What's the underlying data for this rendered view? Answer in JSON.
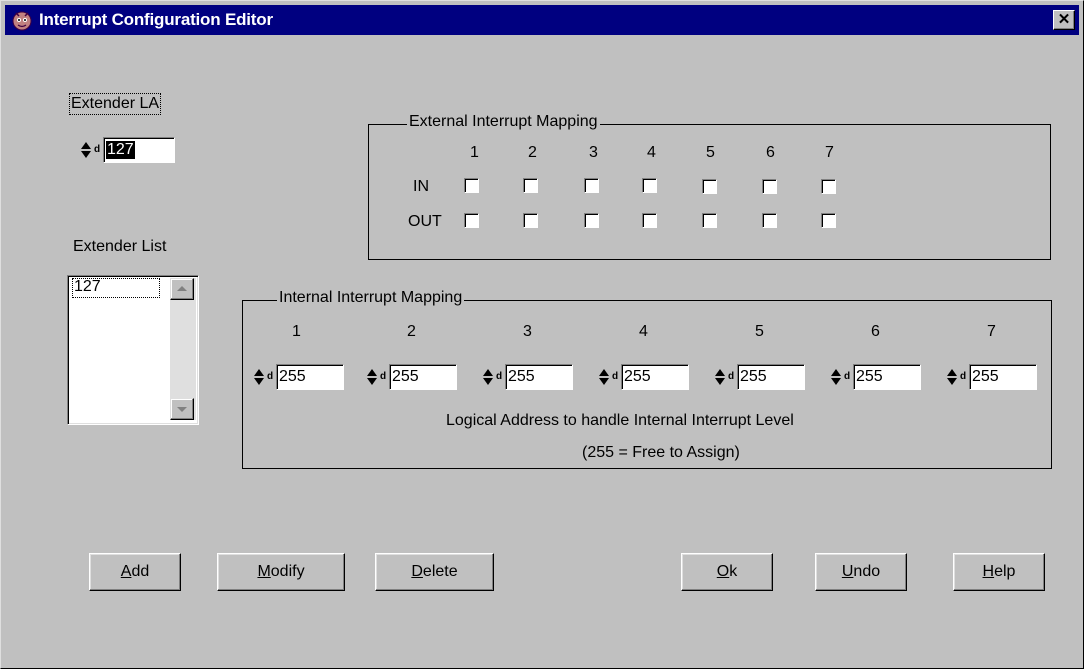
{
  "window": {
    "title": "Interrupt Configuration Editor",
    "close_glyph": "✕"
  },
  "extender_la": {
    "label": "Extender LA",
    "value": "127",
    "unit": "d"
  },
  "extender_list": {
    "label": "Extender List",
    "items": [
      "127"
    ]
  },
  "external": {
    "title": "External Interrupt Mapping",
    "columns": [
      "1",
      "2",
      "3",
      "4",
      "5",
      "6",
      "7"
    ],
    "row_in": "IN",
    "row_out": "OUT"
  },
  "internal": {
    "title": "Internal Interrupt Mapping",
    "columns": [
      "1",
      "2",
      "3",
      "4",
      "5",
      "6",
      "7"
    ],
    "values": [
      "255",
      "255",
      "255",
      "255",
      "255",
      "255",
      "255"
    ],
    "unit": "d",
    "note_line1": "Logical Address to handle Internal Interrupt Level",
    "note_line2": "(255 = Free to Assign)"
  },
  "buttons": {
    "add": {
      "hotkey": "A",
      "rest": "dd"
    },
    "modify": {
      "hotkey": "M",
      "rest": "odify"
    },
    "delete": {
      "hotkey": "D",
      "rest": "elete"
    },
    "ok": {
      "hotkey": "O",
      "rest": "k"
    },
    "undo": {
      "hotkey": "U",
      "rest": "ndo"
    },
    "help": {
      "hotkey": "H",
      "rest": "elp"
    }
  }
}
